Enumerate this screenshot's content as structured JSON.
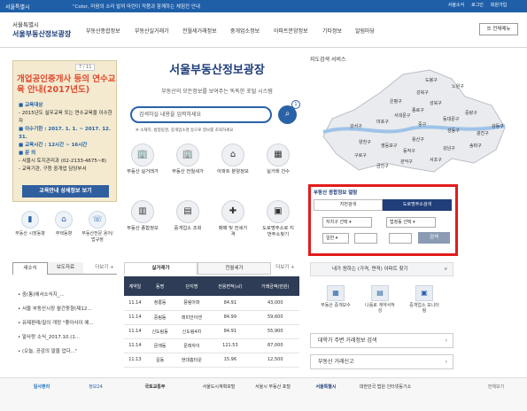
{
  "topbar": {
    "site": "서울특별시",
    "notice": "\"Color, 마음의 소리 발꺼 마련이 작품과 함께하는 체험전 안내",
    "icons": [
      {
        "label": "서울소식",
        "icon": "news-icon"
      },
      {
        "label": "로그인",
        "icon": "login-icon"
      },
      {
        "label": "회원가입",
        "icon": "join-icon"
      }
    ]
  },
  "header": {
    "brand_top": "서울특별시",
    "brand_main": "서울부동산정보광장",
    "nav": [
      "부동산종합정보",
      "부동산실거래가",
      "전월세거래정보",
      "중개업소정보",
      "아파트분양정보",
      "기타정보",
      "알림마당"
    ],
    "all_menu": "전체메뉴"
  },
  "banner": {
    "pager": "7 / 11",
    "heading": "개업공인중개사 등의 연수교육 안내(2017년도)",
    "lines": [
      "■ 교육대상",
      "- 2015년도 실무교육 또는 연수교육을 이수한자",
      "■ 이수기한 : 2017. 1. 1. ~ 2017. 12. 31.",
      "■ 교육시간 : 12시간 ~ 16시간",
      "■ 문 의",
      "- 서울시 토지관리과 (02-2133-4675~8)",
      "- 교육기관, 구청 중개업 담당부서"
    ],
    "button": "교육안내 상세정보 보기"
  },
  "quick_icons": [
    {
      "label": "부동산 시장동향",
      "icon": "chart-icon"
    },
    {
      "label": "주택동향",
      "icon": "house-icon"
    },
    {
      "label": "부동산전문 용어/법규정",
      "icon": "phone-icon"
    }
  ],
  "main": {
    "title": "서울부동산정보광장",
    "tagline": "부동산의 모든정보를 보여주는 똑똑한 포털 시스템",
    "search_placeholder": "검색하실 내용을 입력하세요",
    "search_badge": "1",
    "search_note": "※ 소재지, 법정동명, 중개업소명 등으로 정보를 조회하세요"
  },
  "tiles": [
    {
      "label": "부동산 실거래가",
      "icon": "apartment-icon"
    },
    {
      "label": "부동산 전월세가",
      "icon": "apartment-icon"
    },
    {
      "label": "아파트 분양정보",
      "icon": "home-icon"
    },
    {
      "label": "실거래 건수",
      "icon": "calendar-icon"
    },
    {
      "label": "부동산 종합정보",
      "icon": "building-icon"
    },
    {
      "label": "중개업소 조회",
      "icon": "office-icon"
    },
    {
      "label": "매매 및 전세가격",
      "icon": "puzzle-icon"
    },
    {
      "label": "도로명주소로 지번주소찾기",
      "icon": "monitor-icon"
    }
  ],
  "map": {
    "title": "지도검색 서비스",
    "districts": [
      "도봉구",
      "노원구",
      "강북구",
      "은평구",
      "성북구",
      "중랑구",
      "종로구",
      "서대문구",
      "동대문구",
      "마포구",
      "중구",
      "성동구",
      "광진구",
      "용산구",
      "강서구",
      "양천구",
      "영등포구",
      "동작구",
      "강남구",
      "송파구",
      "강동구",
      "구로구",
      "관악구",
      "서초구",
      "금천구"
    ]
  },
  "rebox": {
    "title": "부동산 종합정보 열람",
    "tab1": "지번검색",
    "tab2": "도로명주소검색",
    "select1": "자치구 선택",
    "select2": "법정동 선택",
    "select3": "일반",
    "button": "검색"
  },
  "wanted": {
    "label": "내가 원하는 (가격, 면적) 아파트 찾기"
  },
  "bottom_icons": [
    {
      "label": "부동산 중개보수",
      "icon": "calculator-icon"
    },
    {
      "label": "나홀로 계약서작성",
      "icon": "document-icon"
    },
    {
      "label": "중개업소 모니터링",
      "icon": "monitor-icon"
    }
  ],
  "linkbars": [
    "대학가 주변 거래정보 검색",
    "부동산 거래신고"
  ],
  "news": {
    "tabs": [
      "새소식",
      "보도자료"
    ],
    "more": "더보기 +",
    "items": [
      "중(통)에서소식지_...",
      "서울 부동산시장 월간동향(제12...",
      "유제판례/질의 개정 \"좋아사이 예...",
      "말사랑 소식_2017.10.(1...",
      "(오늘, 공감의 말을 업다...\""
    ]
  },
  "table": {
    "tabs": [
      "실거래가",
      "전월세가"
    ],
    "more": "더보기 +",
    "headers": [
      "계약일",
      "동명",
      "단지명",
      "전용면적(㎡)",
      "거래금액(만원)"
    ],
    "rows": [
      [
        "11.14",
        "정릉동",
        "풍림아파",
        "84.91",
        "43,000"
      ],
      [
        "11.14",
        "중림동",
        "래미안아센",
        "84.99",
        "59,600"
      ],
      [
        "11.14",
        "신도림동",
        "신도림4차",
        "84.91",
        "55,900"
      ],
      [
        "11.14",
        "문래동",
        "문래자이",
        "121.53",
        "87,000"
      ],
      [
        "11.13",
        "길동",
        "현대홈타운",
        "15.96",
        "12,500"
      ]
    ]
  },
  "footer": {
    "logos": [
      "일사편리",
      "정보24",
      "국토교통부",
      "서울도시계획포털",
      "서울시 부동산 포털",
      "서울특별시",
      "대한민국 법원 인터넷등기소"
    ],
    "more": "전체보기"
  },
  "colors": {
    "primary": "#1f5fa8",
    "navy": "#1f3e7a",
    "highlight": "#e21b1b"
  }
}
